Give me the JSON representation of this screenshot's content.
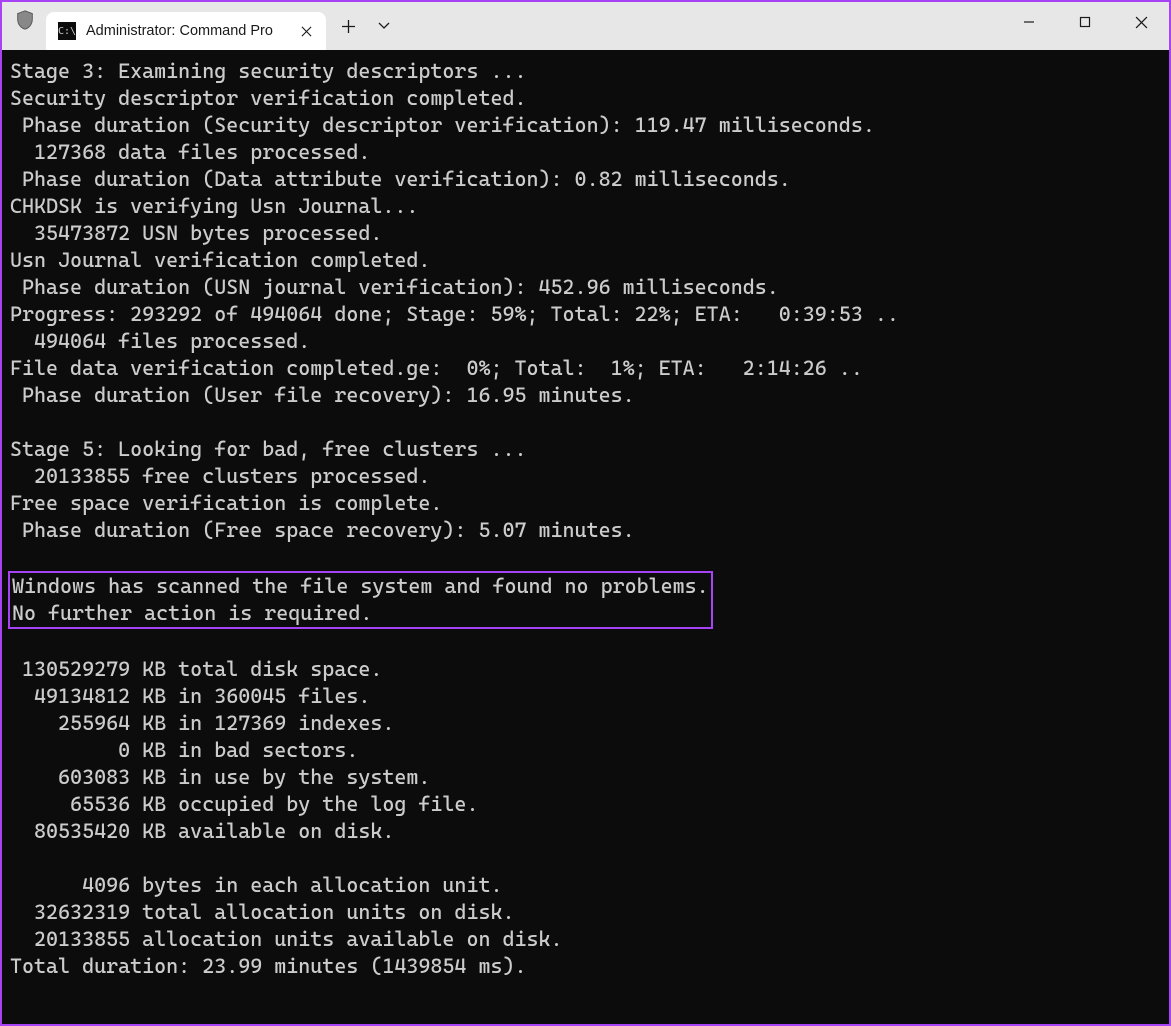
{
  "window": {
    "tab_title": "Administrator: Command Pro"
  },
  "terminal": {
    "lines": [
      "Stage 3: Examining security descriptors ...",
      "Security descriptor verification completed.",
      " Phase duration (Security descriptor verification): 119.47 milliseconds.",
      "  127368 data files processed.",
      " Phase duration (Data attribute verification): 0.82 milliseconds.",
      "CHKDSK is verifying Usn Journal...",
      "  35473872 USN bytes processed.",
      "Usn Journal verification completed.",
      " Phase duration (USN journal verification): 452.96 milliseconds.",
      "Progress: 293292 of 494064 done; Stage: 59%; Total: 22%; ETA:   0:39:53 ..",
      "  494064 files processed.",
      "File data verification completed.ge:  0%; Total:  1%; ETA:   2:14:26 ..",
      " Phase duration (User file recovery): 16.95 minutes.",
      "",
      "Stage 5: Looking for bad, free clusters ...",
      "  20133855 free clusters processed.",
      "Free space verification is complete.",
      " Phase duration (Free space recovery): 5.07 minutes.",
      ""
    ],
    "highlighted": [
      "Windows has scanned the file system and found no problems.",
      "No further action is required."
    ],
    "lines_after": [
      "",
      " 130529279 KB total disk space.",
      "  49134812 KB in 360045 files.",
      "    255964 KB in 127369 indexes.",
      "         0 KB in bad sectors.",
      "    603083 KB in use by the system.",
      "     65536 KB occupied by the log file.",
      "  80535420 KB available on disk.",
      "",
      "      4096 bytes in each allocation unit.",
      "  32632319 total allocation units on disk.",
      "  20133855 allocation units available on disk.",
      "Total duration: 23.99 minutes (1439854 ms)."
    ]
  }
}
